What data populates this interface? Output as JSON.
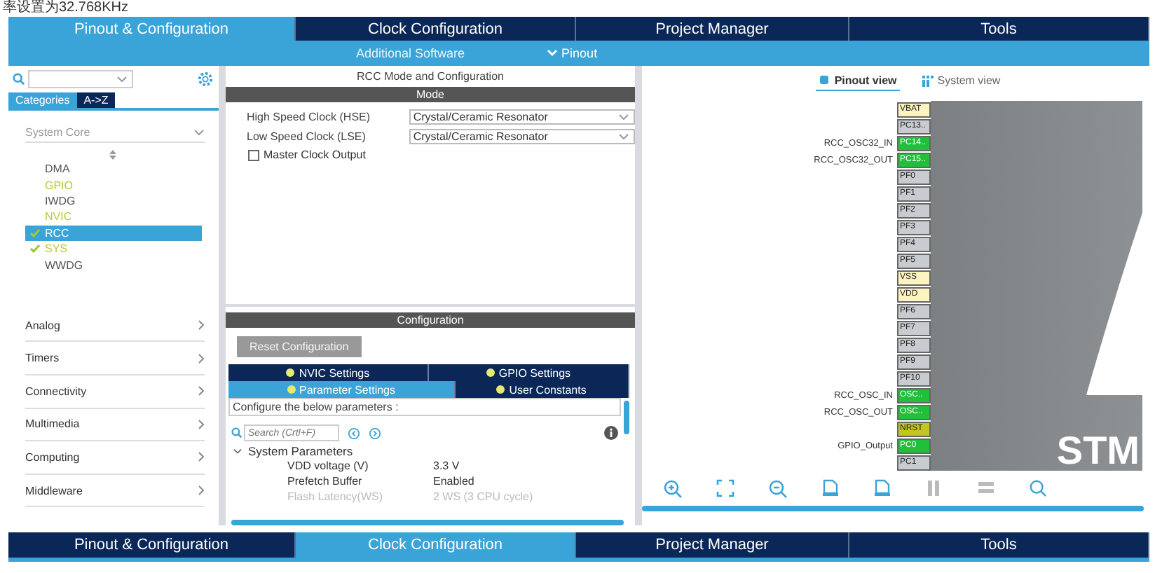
{
  "caption": "率设置为32.768KHz",
  "main_tabs": [
    {
      "label": "Pinout & Configuration",
      "selected": true
    },
    {
      "label": "Clock Configuration",
      "selected": false
    },
    {
      "label": "Project Manager",
      "selected": false
    },
    {
      "label": "Tools",
      "selected": false
    }
  ],
  "sub_bar": {
    "additional_software": "Additional Software",
    "pinout_menu": "Pinout"
  },
  "sidebar": {
    "view_tabs": [
      {
        "label": "Categories",
        "selected": true
      },
      {
        "label": "A->Z",
        "selected": false
      }
    ],
    "category": "System Core",
    "items": [
      {
        "label": "DMA",
        "checked": false,
        "configured": false,
        "selected": false
      },
      {
        "label": "GPIO",
        "checked": false,
        "configured": true,
        "selected": false
      },
      {
        "label": "IWDG",
        "checked": false,
        "configured": false,
        "selected": false
      },
      {
        "label": "NVIC",
        "checked": false,
        "configured": true,
        "selected": false
      },
      {
        "label": "RCC",
        "checked": true,
        "configured": true,
        "selected": true
      },
      {
        "label": "SYS",
        "checked": true,
        "configured": true,
        "selected": false
      },
      {
        "label": "WWDG",
        "checked": false,
        "configured": false,
        "selected": false
      }
    ],
    "groups": [
      "Analog",
      "Timers",
      "Connectivity",
      "Multimedia",
      "Computing",
      "Middleware"
    ]
  },
  "rcc": {
    "title": "RCC Mode and Configuration",
    "mode_header": "Mode",
    "fields": [
      {
        "label": "High Speed Clock (HSE)",
        "value": "Crystal/Ceramic Resonator"
      },
      {
        "label": "Low Speed Clock (LSE)",
        "value": "Crystal/Ceramic Resonator"
      }
    ],
    "master_clock_output": {
      "label": "Master Clock Output",
      "checked": false
    }
  },
  "configuration": {
    "header": "Configuration",
    "reset_button": "Reset Configuration",
    "tab_rows": [
      [
        {
          "label": "NVIC Settings",
          "selected": false
        },
        {
          "label": "GPIO Settings",
          "selected": false
        }
      ],
      [
        {
          "label": "Parameter Settings",
          "selected": true
        },
        {
          "label": "User Constants",
          "selected": false
        }
      ]
    ],
    "hint": "Configure the below parameters :",
    "search": {
      "placeholder": "Search (Crtl+F)"
    },
    "group": {
      "label": "System Parameters",
      "expanded": true
    },
    "params": [
      {
        "name": "VDD voltage (V)",
        "value": "3.3 V",
        "disabled": false
      },
      {
        "name": "Prefetch Buffer",
        "value": "Enabled",
        "disabled": false
      },
      {
        "name": "Flash Latency(WS)",
        "value": "2 WS (3 CPU cycle)",
        "disabled": true
      }
    ]
  },
  "pinout": {
    "view_tabs": [
      {
        "label": "Pinout view",
        "selected": true
      },
      {
        "label": "System view",
        "selected": false
      }
    ],
    "pins": [
      {
        "name": "VBAT",
        "kind": "power"
      },
      {
        "name": "PC13..",
        "kind": "io"
      },
      {
        "name": "PC14..",
        "kind": "assigned",
        "signal": "RCC_OSC32_IN"
      },
      {
        "name": "PC15..",
        "kind": "assigned",
        "signal": "RCC_OSC32_OUT"
      },
      {
        "name": "PF0",
        "kind": "io"
      },
      {
        "name": "PF1",
        "kind": "io"
      },
      {
        "name": "PF2",
        "kind": "io"
      },
      {
        "name": "PF3",
        "kind": "io"
      },
      {
        "name": "PF4",
        "kind": "io"
      },
      {
        "name": "PF5",
        "kind": "io"
      },
      {
        "name": "VSS",
        "kind": "power"
      },
      {
        "name": "VDD",
        "kind": "power"
      },
      {
        "name": "PF6",
        "kind": "io"
      },
      {
        "name": "PF7",
        "kind": "io"
      },
      {
        "name": "PF8",
        "kind": "io"
      },
      {
        "name": "PF9",
        "kind": "io"
      },
      {
        "name": "PF10",
        "kind": "io"
      },
      {
        "name": "OSC..",
        "kind": "assigned",
        "signal": "RCC_OSC_IN"
      },
      {
        "name": "OSC..",
        "kind": "assigned",
        "signal": "RCC_OSC_OUT"
      },
      {
        "name": "NRST",
        "kind": "reset"
      },
      {
        "name": "PC0",
        "kind": "assigned",
        "signal": "GPIO_Output"
      },
      {
        "name": "PC1",
        "kind": "io"
      }
    ],
    "chip_text": "STM"
  },
  "bottom_tabs": [
    {
      "label": "Pinout & Configuration",
      "selected": false
    },
    {
      "label": "Clock Configuration",
      "selected": true
    },
    {
      "label": "Project Manager",
      "selected": false
    },
    {
      "label": "Tools",
      "selected": false
    }
  ]
}
